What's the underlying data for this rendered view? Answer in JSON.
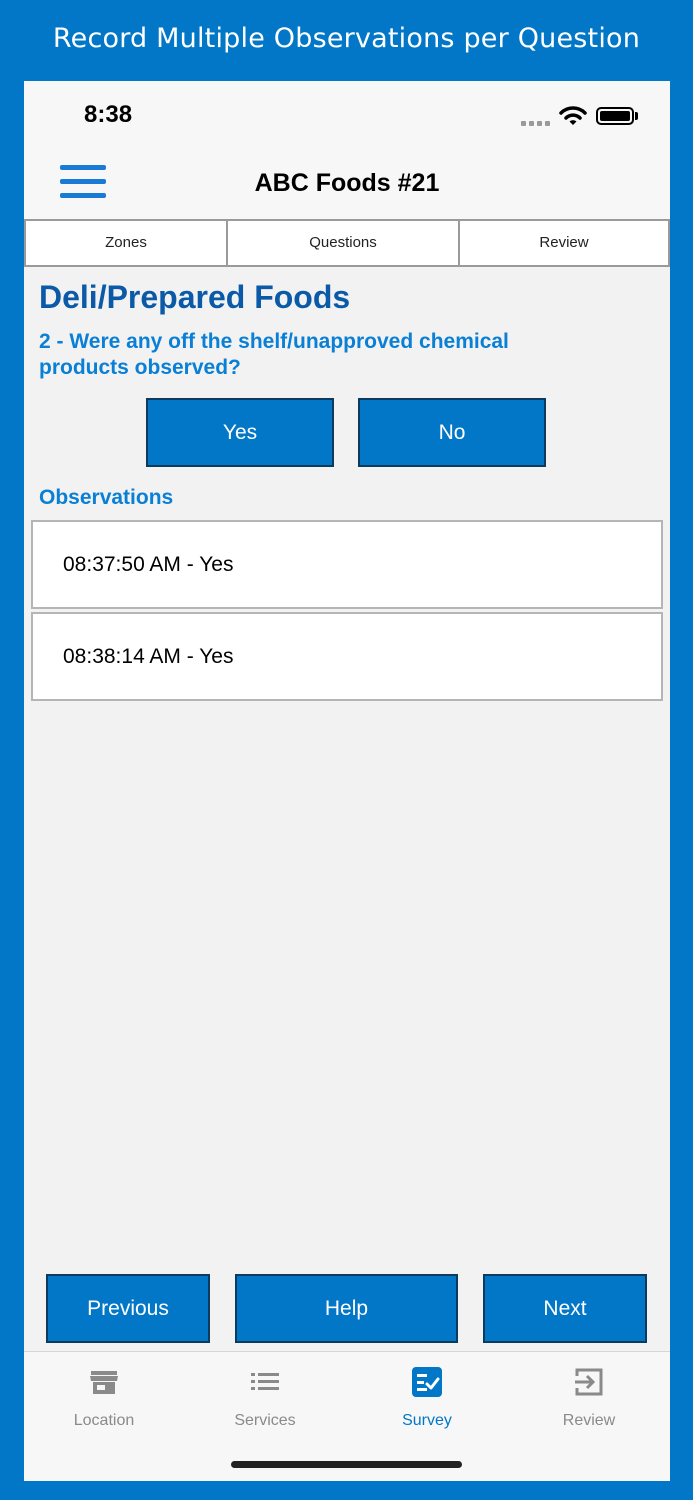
{
  "banner": {
    "text": "Record Multiple Observations per Question"
  },
  "status_bar": {
    "time": "8:38"
  },
  "nav": {
    "title": "ABC Foods #21"
  },
  "segments": [
    {
      "label": "Zones"
    },
    {
      "label": "Questions"
    },
    {
      "label": "Review"
    }
  ],
  "zone": {
    "title": "Deli/Prepared Foods"
  },
  "question": {
    "text": "2 - Were any off the shelf/unapproved chemical products observed?"
  },
  "answers": {
    "yes": "Yes",
    "no": "No"
  },
  "observations": {
    "label": "Observations",
    "items": [
      {
        "text": "08:37:50 AM - Yes"
      },
      {
        "text": "08:38:14 AM - Yes"
      }
    ]
  },
  "actions": {
    "previous": "Previous",
    "help": "Help",
    "next": "Next"
  },
  "tabs": [
    {
      "label": "Location",
      "icon": "store-icon"
    },
    {
      "label": "Services",
      "icon": "list-icon"
    },
    {
      "label": "Survey",
      "icon": "survey-check-icon",
      "active": true
    },
    {
      "label": "Review",
      "icon": "exit-arrow-icon"
    }
  ],
  "colors": {
    "brand": "#0277c8",
    "title": "#0a5aa8",
    "accent_text": "#0a7fd6",
    "inactive_tab": "#8a8a8a"
  }
}
